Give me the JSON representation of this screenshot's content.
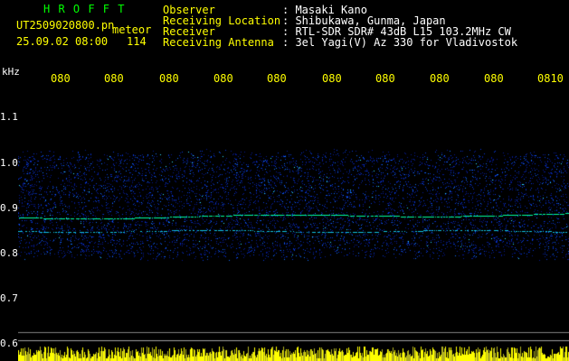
{
  "header": {
    "program": "H R O F F T",
    "filename": "UT2509020800.pn",
    "type_label": "meteor",
    "datetime": "25.09.02 08:00",
    "count": "114",
    "info_labels": [
      "Observer",
      "Receiving Location",
      "Receiver",
      "Receiving Antenna"
    ],
    "info_values": [
      ": Masaki Kano",
      ": Shibukawa, Gunma, Japan",
      ": RTL-SDR SDR# 43dB L15 103.2MHz CW",
      ": 3el Yagi(V) Az 330 for Vladivostok"
    ]
  },
  "axis": {
    "unit": "kHz",
    "time_ticks": [
      "080",
      "080",
      "080",
      "080",
      "080",
      "080",
      "080",
      "080",
      "080",
      "0810"
    ],
    "freq_ticks": [
      "1.1",
      "1.0",
      "0.9",
      "0.8",
      "0.7",
      "0.6"
    ]
  },
  "colors": {
    "time_tick": "#ffff00",
    "freq_tick": "#ffffff",
    "header_label": "#ffff00",
    "header_value": "#ffffff",
    "program": "#00ff00",
    "echo_line": "#00ffa0",
    "noise_band": "#0020ff",
    "bottom_signal": "#ffff00"
  }
}
